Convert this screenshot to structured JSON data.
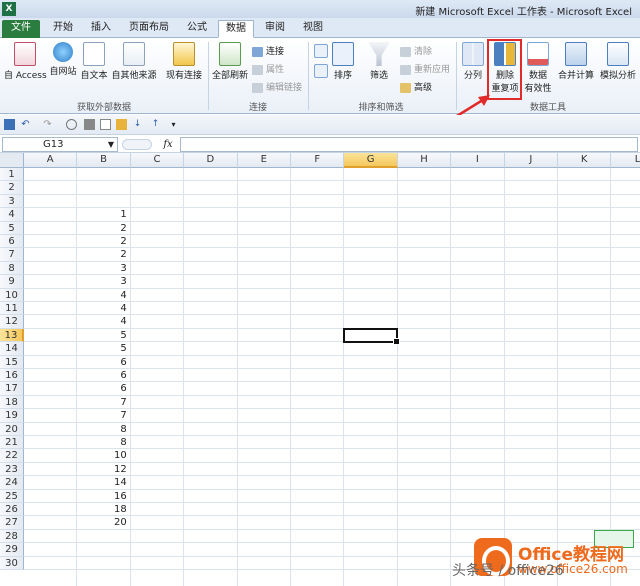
{
  "window": {
    "app_icon": "X",
    "title": "新建 Microsoft Excel 工作表 - Microsoft Excel"
  },
  "tabs": [
    {
      "label": "文件",
      "state": "file"
    },
    {
      "label": "开始",
      "state": ""
    },
    {
      "label": "插入",
      "state": ""
    },
    {
      "label": "页面布局",
      "state": ""
    },
    {
      "label": "公式",
      "state": ""
    },
    {
      "label": "数据",
      "state": "active"
    },
    {
      "label": "审阅",
      "state": ""
    },
    {
      "label": "视图",
      "state": ""
    }
  ],
  "ribbon": {
    "external": {
      "group_label": "获取外部数据",
      "buttons": [
        "自 Access",
        "自网站",
        "自文本",
        "自其他来源",
        "现有连接"
      ]
    },
    "connections": {
      "group_label": "连接",
      "refresh": "全部刷新",
      "items": [
        "连接",
        "属性",
        "编辑链接"
      ]
    },
    "sort_filter": {
      "group_label": "排序和筛选",
      "sort": "排序",
      "filter": "筛选",
      "items": [
        "清除",
        "重新应用",
        "高级"
      ]
    },
    "data_tools": {
      "group_label": "数据工具",
      "split": "分列",
      "remove_dup_1": "删除",
      "remove_dup_2": "重复项",
      "validation_1": "数据",
      "validation_2": "有效性",
      "consolidate": "合并计算",
      "whatif": "模拟分析"
    }
  },
  "formula_bar": {
    "name_box": "G13",
    "fx": "fx",
    "value": ""
  },
  "sheet": {
    "columns": [
      "A",
      "B",
      "C",
      "D",
      "E",
      "F",
      "G",
      "H",
      "I",
      "J",
      "K",
      "L"
    ],
    "selected_column": "G",
    "selected_row": 13,
    "rows": [
      "1",
      "2",
      "3",
      "4",
      "5",
      "6",
      "7",
      "8",
      "9",
      "10",
      "11",
      "12",
      "13",
      "14",
      "15",
      "16",
      "17",
      "18",
      "19",
      "20",
      "21",
      "22",
      "23",
      "24",
      "25",
      "26",
      "27",
      "28",
      "29",
      "30"
    ],
    "column_b_values": {
      "4": "1",
      "5": "2",
      "6": "2",
      "7": "2",
      "8": "3",
      "9": "3",
      "10": "4",
      "11": "4",
      "12": "4",
      "13": "5",
      "14": "5",
      "15": "6",
      "16": "6",
      "17": "6",
      "18": "7",
      "19": "7",
      "20": "8",
      "21": "8",
      "22": "10",
      "23": "12",
      "24": "14",
      "25": "16",
      "26": "18",
      "27": "20"
    }
  },
  "watermark": {
    "brand": "Office教程网",
    "url": "www.office26.com",
    "signature": "头条号 / office26"
  },
  "colors": {
    "file_tab": "#2a7d3e",
    "highlight": "#e12b2b",
    "selected_header": "#f5c85c",
    "watermark": "#ee6a1c"
  }
}
